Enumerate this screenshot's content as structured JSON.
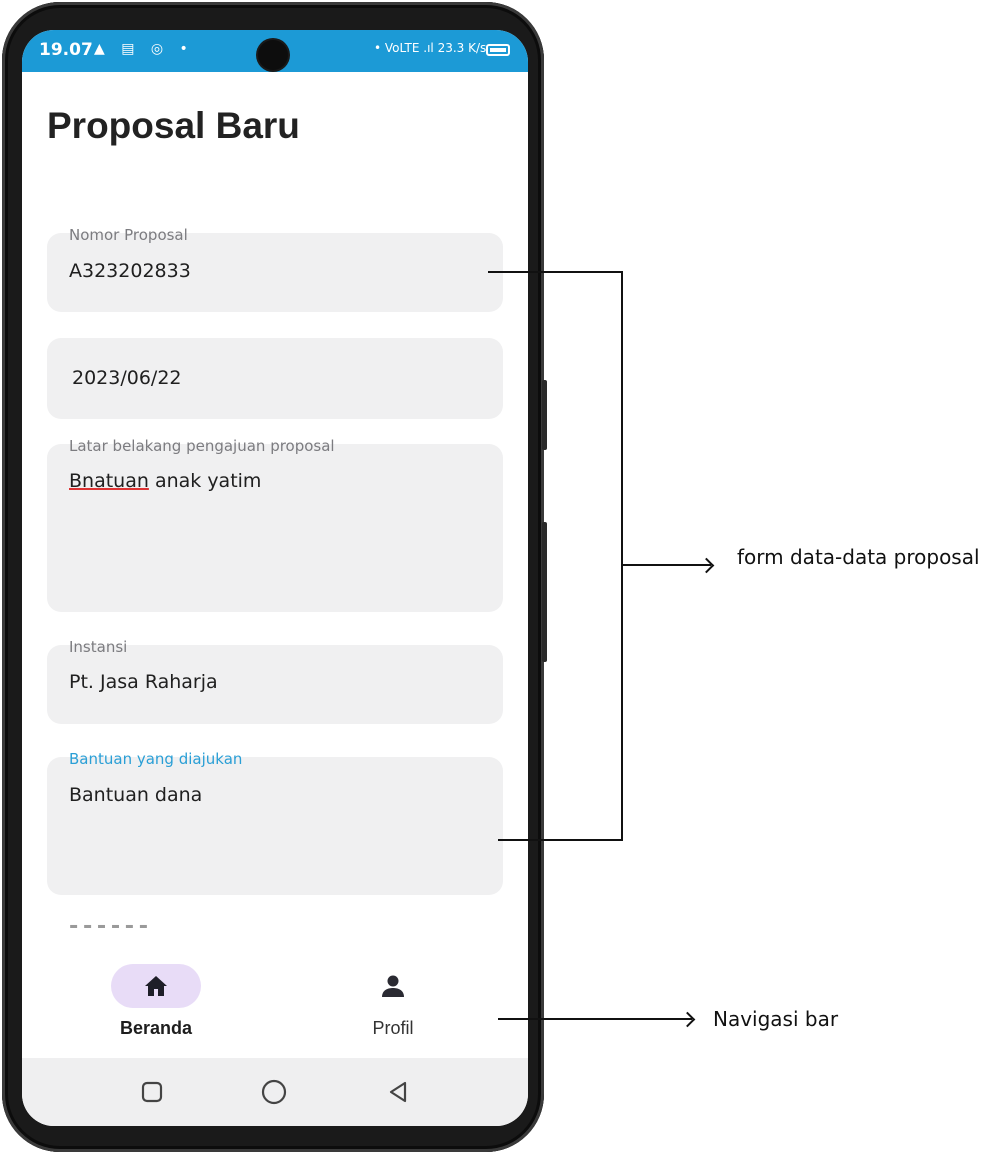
{
  "status_bar": {
    "time": "19.07",
    "left_icons": "▲ ▤ ◎ •",
    "right_text": "•  VoLTE .ıl 23.3 K/s"
  },
  "page": {
    "title": "Proposal Baru"
  },
  "form": {
    "nomor_label": "Nomor Proposal",
    "nomor_value": "A323202833",
    "tanggal_value": "2023/06/22",
    "latar_label": "Latar belakang pengajuan proposal",
    "latar_value_misspelled": "Bnatuan",
    "latar_value_rest": " anak yatim",
    "instansi_label": "Instansi",
    "instansi_value": "Pt. Jasa Raharja",
    "bantuan_label": "Bantuan yang diajukan",
    "bantuan_value": "Bantuan dana"
  },
  "bottom_nav": {
    "items": [
      {
        "label": "Beranda",
        "icon": "home-icon",
        "active": true
      },
      {
        "label": "Profil",
        "icon": "person-icon",
        "active": false
      }
    ]
  },
  "annotations": {
    "form_label": "form data-data proposal",
    "nav_label": "Navigasi bar"
  },
  "colors": {
    "status_bar": "#1c9ad6",
    "field_bg": "#f0f0f1",
    "active_label": "#2a9fd6",
    "nav_active_pill": "#e8dcf7"
  }
}
